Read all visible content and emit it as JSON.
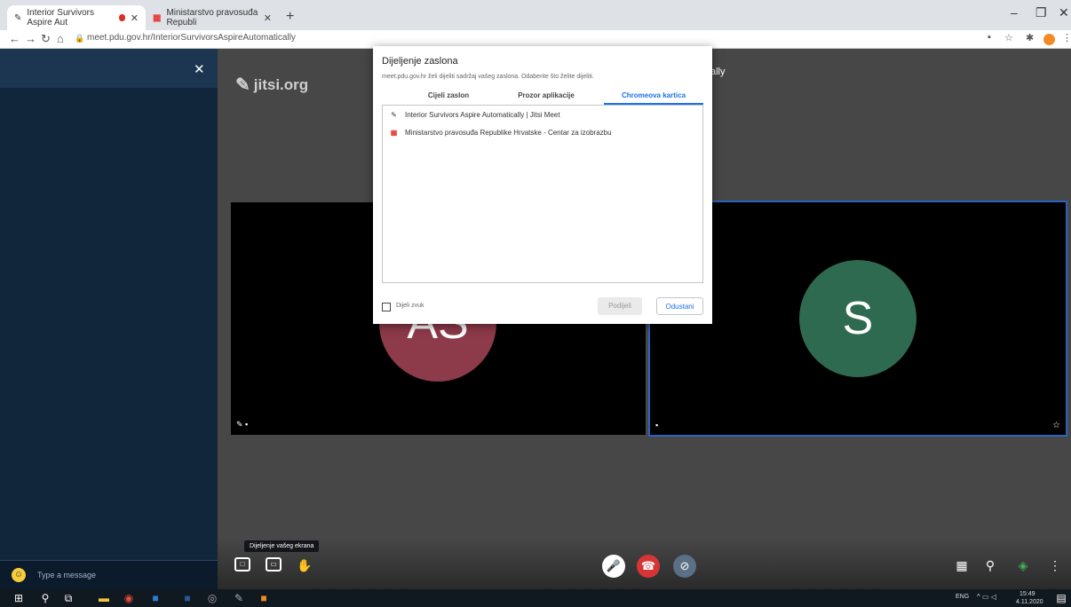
{
  "browser": {
    "tabs": [
      {
        "label": "Interior Survivors Aspire Aut",
        "close": "✕"
      },
      {
        "label": "Ministarstvo pravosuđa Republi",
        "close": "✕"
      }
    ],
    "new_tab": "+",
    "url": "meet.pdu.gov.hr/InteriorSurvivorsAspireAutomatically",
    "window_controls": {
      "minimize": "–",
      "maximize": "❐",
      "close": "✕"
    }
  },
  "chat": {
    "close": "✕",
    "input_placeholder": "Type a message"
  },
  "stage": {
    "watermark": "jitsi.org",
    "meeting_title_fragment": "ally",
    "left_tile": {
      "initials": "AS",
      "label": "✎ ▪",
      "avatar_color": "#8d3a4a"
    },
    "right_tile": {
      "initials": "S",
      "label": "▪",
      "avatar_color": "#2e6a4f",
      "star": "☆"
    }
  },
  "toolbar": {
    "tooltip": "Dijeljenje vašeg ekrana",
    "chat_icon": "□",
    "share_icon": "▭",
    "raise_hand_icon": "✋",
    "mic_icon": "🎤",
    "hangup_icon": "☎",
    "camera_icon": "⊘",
    "tile_icon": "▦",
    "invite_icon": "⚲",
    "security_icon": "◈",
    "more_icon": "⋮"
  },
  "taskbar": {
    "clock_time": "15:49",
    "clock_date": "4.11.2020",
    "tray": "ENG"
  },
  "dialog": {
    "title": "Dijeljenje zaslona",
    "subtitle": "meet.pdu.gov.hr želi dijeliti sadržaj vašeg zaslona. Odaberite što želite dijeliti.",
    "tabs": [
      "Cijeli zaslon",
      "Prozor aplikacije",
      "Chromeova kartica"
    ],
    "active_tab": 2,
    "items": [
      {
        "label": "Interior Survivors Aspire Automatically | Jitsi Meet"
      },
      {
        "label": "Ministarstvo pravosuđa Republike Hrvatske - Centar za izobrazbu"
      }
    ],
    "share_audio_label": "Dijeli zvuk",
    "share_button": "Podijeli",
    "cancel_button": "Odustani"
  }
}
